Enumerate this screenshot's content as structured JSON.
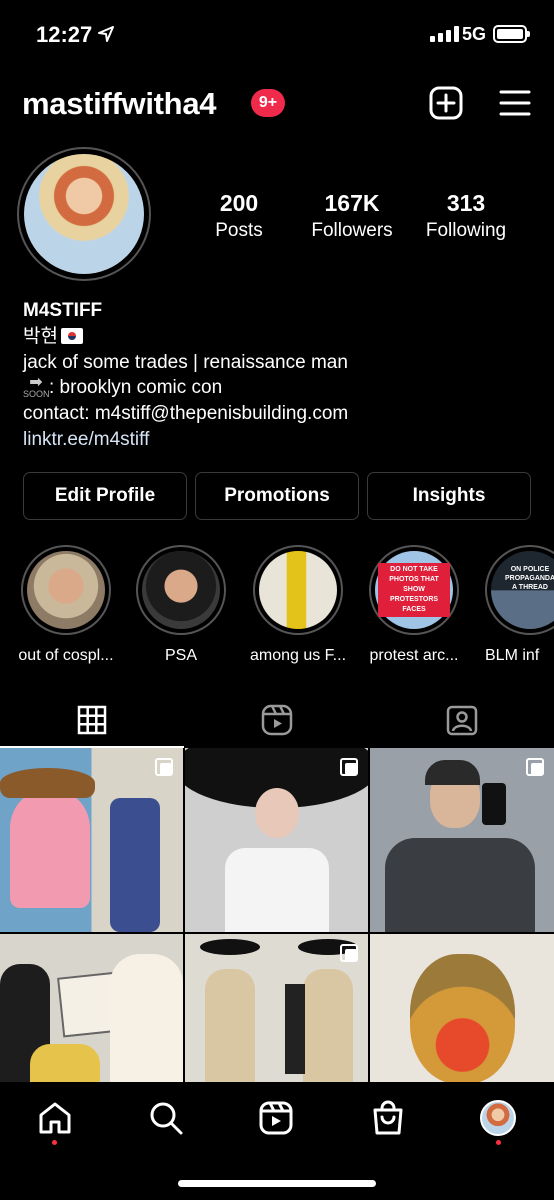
{
  "status_bar": {
    "time": "12:27",
    "network": "5G"
  },
  "header": {
    "username": "mastiffwitha4",
    "notification_badge": "9+"
  },
  "stats": [
    {
      "value": "200",
      "label": "Posts"
    },
    {
      "value": "167K",
      "label": "Followers"
    },
    {
      "value": "313",
      "label": "Following"
    }
  ],
  "bio": {
    "name": "M4STIFF",
    "korean_name": "박현",
    "line1": "jack of some trades | renaissance man",
    "soon_label": "SOON",
    "line2": ": brooklyn comic con",
    "line3": "contact: m4stiff@thepenisbuilding.com",
    "link": "linktr.ee/m4stiff"
  },
  "buttons": {
    "edit_profile": "Edit Profile",
    "promotions": "Promotions",
    "insights": "Insights"
  },
  "highlights": [
    {
      "label": "out of cospl...",
      "color": "#c9b89a"
    },
    {
      "label": "PSA",
      "color": "#2b2b2b"
    },
    {
      "label": "among us F...",
      "color": "#e8e4d8"
    },
    {
      "label": "protest arc...",
      "color": "#9fc4e6"
    },
    {
      "label": "BLM inf",
      "color": "#5a6f85"
    }
  ],
  "highlight_texts": {
    "protest": "DO NOT TAKE PHOTOS THAT SHOW PROTESTORS FACES",
    "blm": "ON POLICE PROPAGANDA: A THREAD"
  },
  "tabs": [
    "grid-icon",
    "reels-icon",
    "tagged-icon"
  ],
  "grid_posts": [
    {
      "color": "#6fa3c8",
      "multi": true
    },
    {
      "color": "#c8c8c8",
      "multi": true
    },
    {
      "color": "#8a8f96",
      "multi": true
    },
    {
      "color": "#d8d6cc",
      "multi": false
    },
    {
      "color": "#c9bfa8",
      "multi": true
    },
    {
      "color": "#c08a5a",
      "multi": false
    }
  ],
  "nav": [
    "home-icon",
    "search-icon",
    "reels-icon",
    "shop-icon",
    "profile-avatar"
  ]
}
